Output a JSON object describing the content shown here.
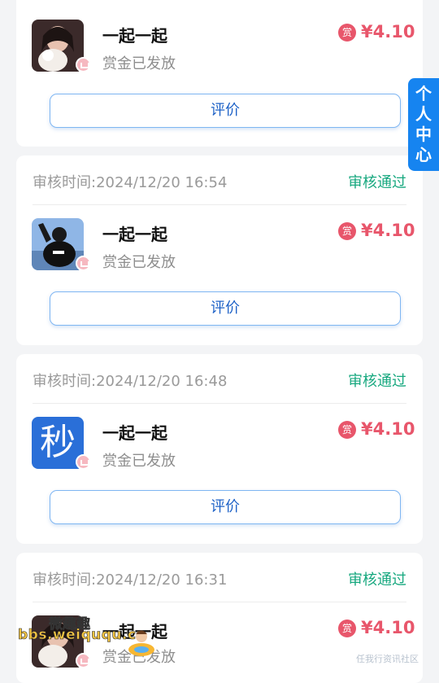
{
  "side_tab": {
    "chars": [
      "个",
      "人",
      "中",
      "心"
    ]
  },
  "button_label": "评价",
  "reward_icon_label": "赏",
  "cards": [
    {
      "review_time": "",
      "status": "",
      "title": "一起一起",
      "subtitle": "赏金已发放",
      "amount": "¥4.10",
      "avatar": "photo-woman"
    },
    {
      "review_time": "审核时间:2024/12/20 16:54",
      "status": "审核通过",
      "title": "一起一起",
      "subtitle": "赏金已发放",
      "amount": "¥4.10",
      "avatar": "photo-man"
    },
    {
      "review_time": "审核时间:2024/12/20 16:48",
      "status": "审核通过",
      "title": "一起一起",
      "subtitle": "赏金已发放",
      "amount": "¥4.10",
      "avatar": "秒"
    },
    {
      "review_time": "审核时间:2024/12/20 16:31",
      "status": "审核通过",
      "title": "一起一起",
      "subtitle": "赏金已发放",
      "amount": "¥4.10",
      "avatar": "photo-woman"
    }
  ],
  "watermark": {
    "url": "bbs.weiququ.cn",
    "cn": "微趣趣",
    "corner": "任我行资讯社区"
  },
  "colors": {
    "accent": "#1684f0",
    "reward": "#e8566b",
    "status": "#17a87f"
  }
}
